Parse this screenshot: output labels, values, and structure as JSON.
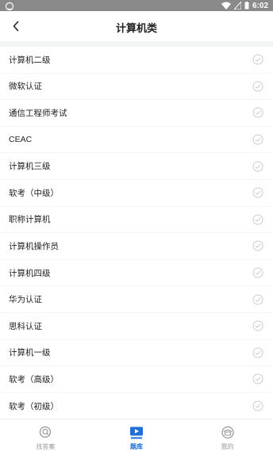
{
  "status_bar": {
    "time": "6:02",
    "icons": [
      "cloud-icon",
      "wifi-icon",
      "signal-icon",
      "battery-icon"
    ]
  },
  "header": {
    "title": "计算机类",
    "back_icon": "chevron-left-icon"
  },
  "list": {
    "items": [
      {
        "label": "计算机二级"
      },
      {
        "label": "微软认证"
      },
      {
        "label": "通信工程师考试"
      },
      {
        "label": "CEAC"
      },
      {
        "label": "计算机三级"
      },
      {
        "label": "软考（中级）"
      },
      {
        "label": "职称计算机"
      },
      {
        "label": "计算机操作员"
      },
      {
        "label": "计算机四级"
      },
      {
        "label": "华为认证"
      },
      {
        "label": "思科认证"
      },
      {
        "label": "计算机一级"
      },
      {
        "label": "软考（高级）"
      },
      {
        "label": "软考（初级）"
      }
    ],
    "check_icon": "check-circle-icon"
  },
  "tab_bar": {
    "tabs": [
      {
        "label": "找答案",
        "icon": "search-icon",
        "active": false
      },
      {
        "label": "题库",
        "icon": "play-flag-icon",
        "active": true
      },
      {
        "label": "我的",
        "icon": "profile-icon",
        "active": false
      }
    ]
  },
  "colors": {
    "accent": "#1f6fd8",
    "status_bar": "#8a8a8a",
    "check": "#cccccc",
    "inactive_tab": "#999999"
  }
}
